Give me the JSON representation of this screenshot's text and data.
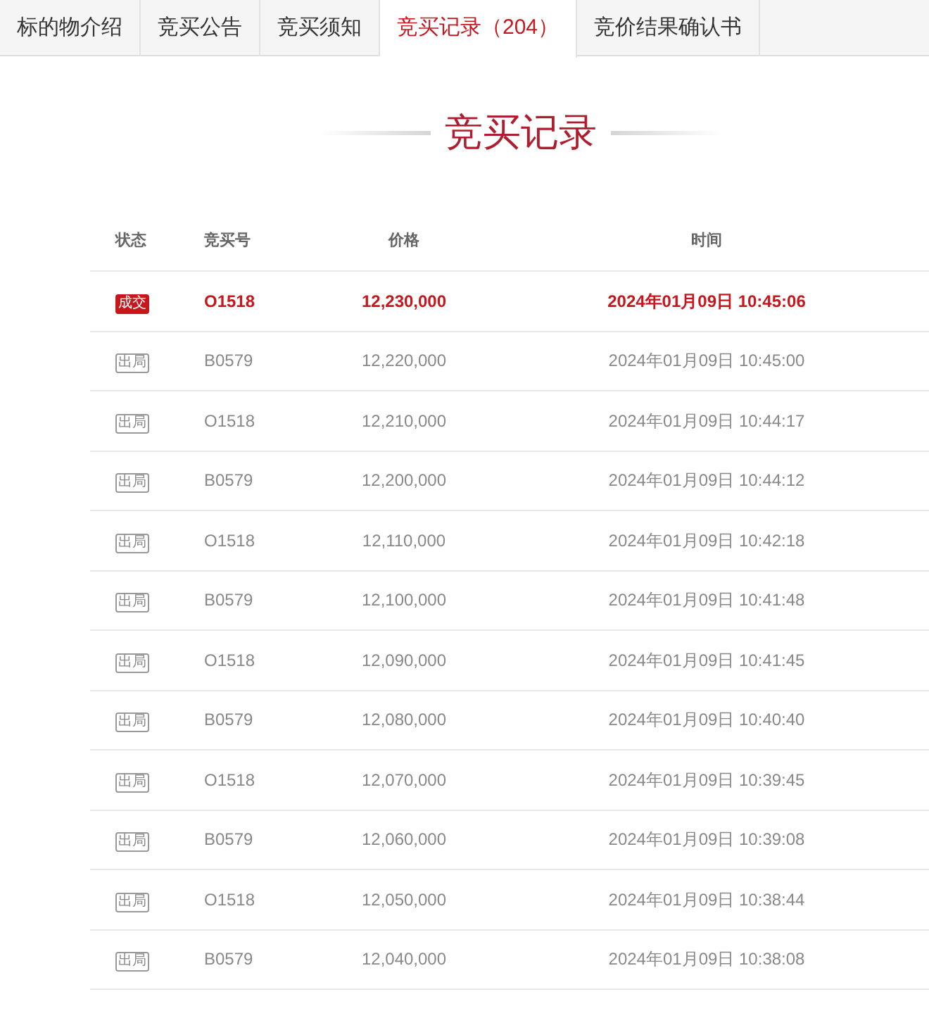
{
  "tabs": [
    {
      "label": "标的物介绍",
      "selected": false
    },
    {
      "label": "竞买公告",
      "selected": false
    },
    {
      "label": "竞买须知",
      "selected": false
    },
    {
      "label": "竞买记录（204）",
      "selected": true
    },
    {
      "label": "竞价结果确认书",
      "selected": false
    }
  ],
  "heading": "竞买记录",
  "table": {
    "columns": [
      "状态",
      "竞买号",
      "价格",
      "时间"
    ],
    "rows": [
      {
        "kind": "won",
        "status": "成交",
        "bidder": "O1518",
        "price": "12,230,000",
        "time": "2024年01月09日 10:45:06"
      },
      {
        "kind": "out",
        "status": "出局",
        "bidder": "B0579",
        "price": "12,220,000",
        "time": "2024年01月09日 10:45:00"
      },
      {
        "kind": "out",
        "status": "出局",
        "bidder": "O1518",
        "price": "12,210,000",
        "time": "2024年01月09日 10:44:17"
      },
      {
        "kind": "out",
        "status": "出局",
        "bidder": "B0579",
        "price": "12,200,000",
        "time": "2024年01月09日 10:44:12"
      },
      {
        "kind": "out",
        "status": "出局",
        "bidder": "O1518",
        "price": "12,110,000",
        "time": "2024年01月09日 10:42:18"
      },
      {
        "kind": "out",
        "status": "出局",
        "bidder": "B0579",
        "price": "12,100,000",
        "time": "2024年01月09日 10:41:48"
      },
      {
        "kind": "out",
        "status": "出局",
        "bidder": "O1518",
        "price": "12,090,000",
        "time": "2024年01月09日 10:41:45"
      },
      {
        "kind": "out",
        "status": "出局",
        "bidder": "B0579",
        "price": "12,080,000",
        "time": "2024年01月09日 10:40:40"
      },
      {
        "kind": "out",
        "status": "出局",
        "bidder": "O1518",
        "price": "12,070,000",
        "time": "2024年01月09日 10:39:45"
      },
      {
        "kind": "out",
        "status": "出局",
        "bidder": "B0579",
        "price": "12,060,000",
        "time": "2024年01月09日 10:39:08"
      },
      {
        "kind": "out",
        "status": "出局",
        "bidder": "O1518",
        "price": "12,050,000",
        "time": "2024年01月09日 10:38:44"
      },
      {
        "kind": "out",
        "status": "出局",
        "bidder": "B0579",
        "price": "12,040,000",
        "time": "2024年01月09日 10:38:08"
      }
    ]
  }
}
